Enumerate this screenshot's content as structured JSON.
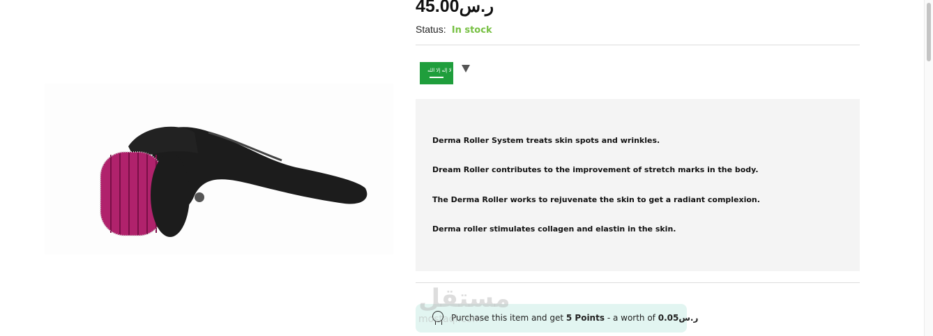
{
  "product": {
    "price": "45.00ر.س",
    "status_label": "Status:",
    "status_value": "In stock",
    "flag_text": "لا إله إلا الله",
    "description": [
      "Derma Roller System treats skin spots and wrinkles.",
      "Dream Roller contributes to the improvement of stretch marks in the body.",
      "The Derma Roller works to rejuvenate the skin to get a radiant complexion.",
      "Derma roller stimulates collagen and elastin in the skin."
    ],
    "points": {
      "prefix": "Purchase this item and get",
      "points": "5 Points",
      "middle": "- a worth of",
      "amount": "0.05ر.س"
    }
  },
  "watermark": {
    "text": "مستقل",
    "sub": "mostaql.com"
  },
  "colors": {
    "in_stock": "#77c043",
    "flag_green": "#1f9e3c",
    "desc_bg": "#f4f4f4",
    "points_bg": "#e2f5f1",
    "roller_pink": "#b0226c",
    "handle_black": "#1c1c1c"
  }
}
